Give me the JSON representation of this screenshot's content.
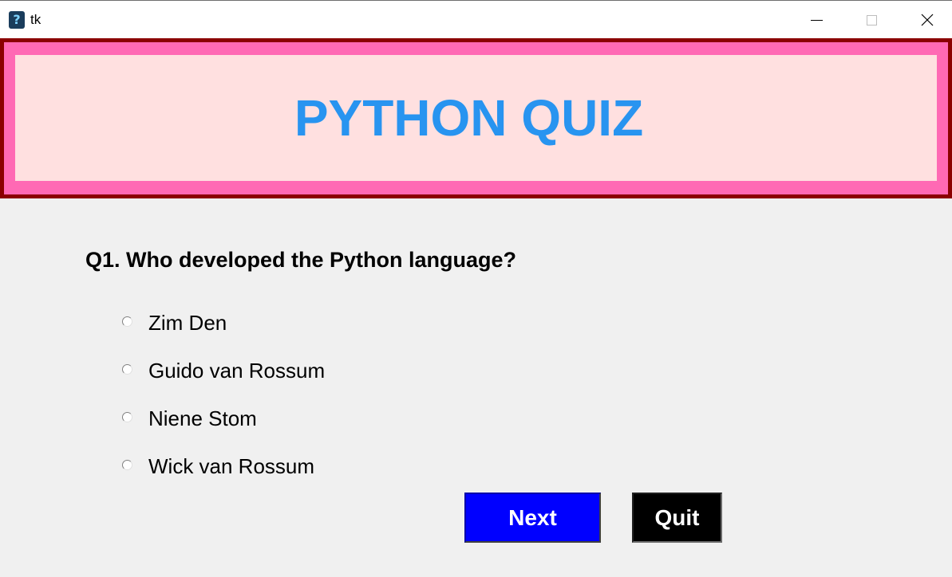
{
  "window": {
    "title": "tk",
    "icon": "question-mark-app-icon"
  },
  "banner": {
    "title": "PYTHON QUIZ"
  },
  "question": {
    "text": "Q1. Who developed the Python language?",
    "options": [
      "Zim Den",
      "Guido van Rossum",
      "Niene Stom",
      "Wick van Rossum"
    ]
  },
  "buttons": {
    "next_label": "Next",
    "quit_label": "Quit"
  },
  "colors": {
    "banner_border": "#8b0000",
    "banner_frame": "#ff69b4",
    "banner_bg": "#ffe0e0",
    "title_text": "#2894f0",
    "next_button": "#0000ff",
    "quit_button": "#000000"
  }
}
